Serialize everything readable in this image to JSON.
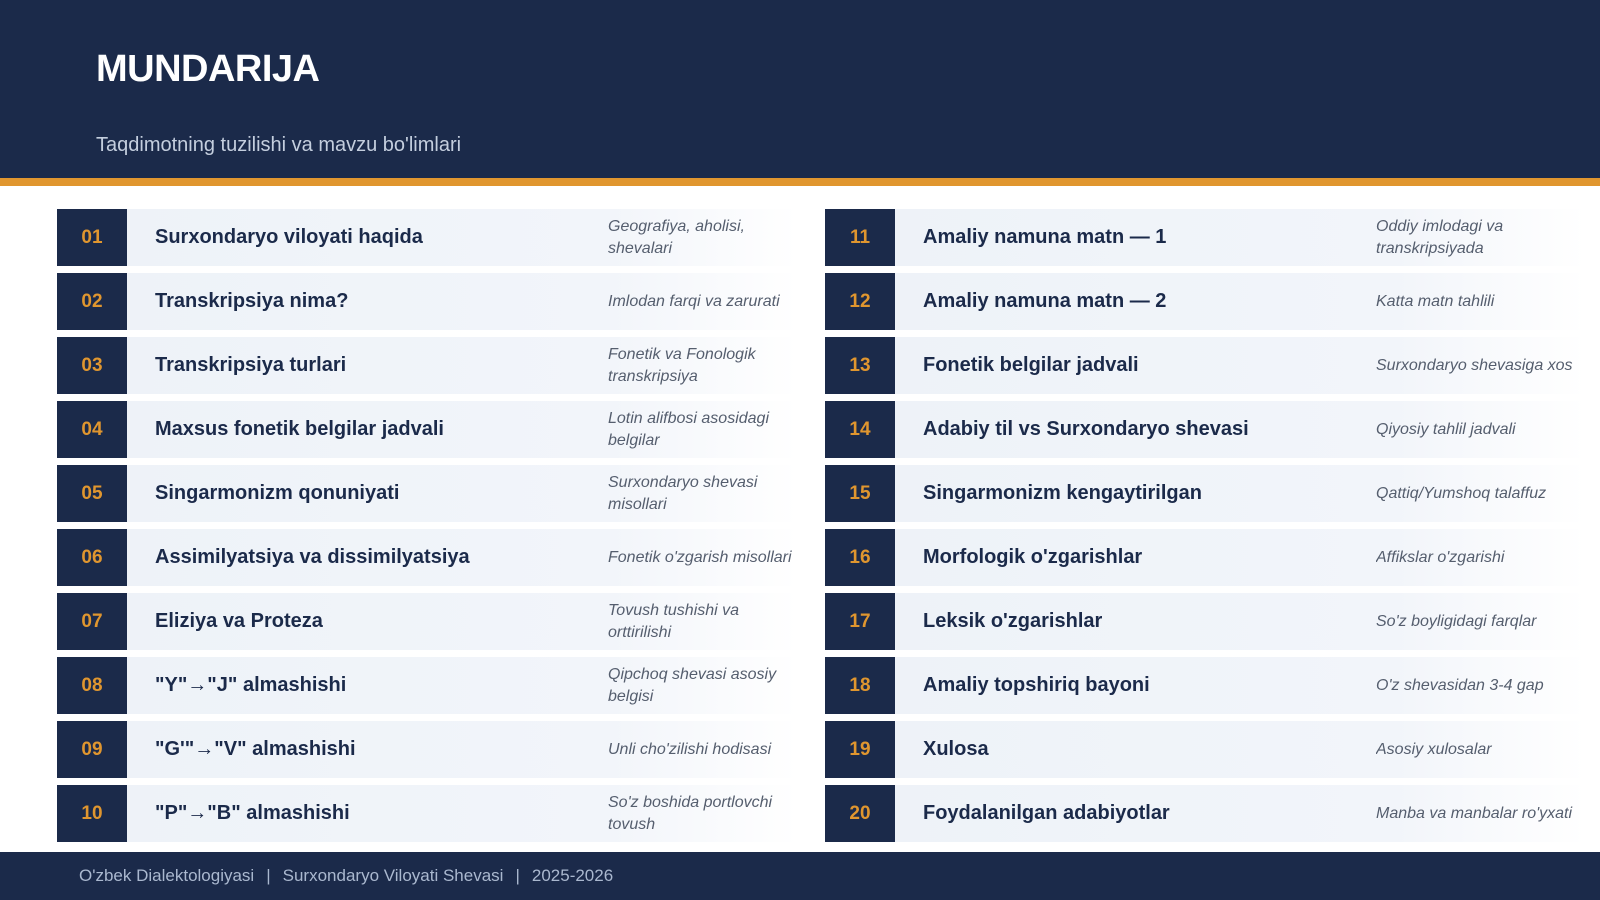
{
  "header": {
    "title": "MUNDARIJA",
    "subtitle": "Taqdimotning tuzilishi va mavzu bo'limlari"
  },
  "colors": {
    "navy": "#1b2a4a",
    "accent": "#e0962f",
    "row_bg": "#edf2f8"
  },
  "items_left": [
    {
      "num": "01",
      "title": "Surxondaryo viloyati haqida",
      "desc": "Geografiya, aholisi, shevalari"
    },
    {
      "num": "02",
      "title": "Transkripsiya nima?",
      "desc": "Imlodan farqi va zarurati"
    },
    {
      "num": "03",
      "title": "Transkripsiya turlari",
      "desc": "Fonetik va Fonologik transkripsiya"
    },
    {
      "num": "04",
      "title": "Maxsus fonetik belgilar jadvali",
      "desc": "Lotin alifbosi asosidagi belgilar"
    },
    {
      "num": "05",
      "title": "Singarmonizm qonuniyati",
      "desc": "Surxondaryo shevasi misollari"
    },
    {
      "num": "06",
      "title": "Assimilyatsiya va dissimilyatsiya",
      "desc": "Fonetik o'zgarish misollari"
    },
    {
      "num": "07",
      "title": "Eliziya va Proteza",
      "desc": "Tovush tushishi va orttirilishi"
    },
    {
      "num": "08",
      "title": "\"Y\"→\"J\" almashishi",
      "desc": "Qipchoq shevasi asosiy belgisi"
    },
    {
      "num": "09",
      "title": "\"G'\"→\"V\" almashishi",
      "desc": "Unli cho'zilishi hodisasi"
    },
    {
      "num": "10",
      "title": "\"P\"→\"B\" almashishi",
      "desc": "So'z boshida portlovchi tovush"
    }
  ],
  "items_right": [
    {
      "num": "11",
      "title": "Amaliy namuna matn — 1",
      "desc": "Oddiy imlodagi va transkripsiyada"
    },
    {
      "num": "12",
      "title": "Amaliy namuna matn — 2",
      "desc": "Katta matn tahlili"
    },
    {
      "num": "13",
      "title": "Fonetik belgilar jadvali",
      "desc": "Surxondaryo shevasiga xos"
    },
    {
      "num": "14",
      "title": "Adabiy til vs Surxondaryo shevasi",
      "desc": "Qiyosiy tahlil jadvali"
    },
    {
      "num": "15",
      "title": "Singarmonizm kengaytirilgan",
      "desc": "Qattiq/Yumshoq talaffuz"
    },
    {
      "num": "16",
      "title": "Morfologik o'zgarishlar",
      "desc": "Affikslar o'zgarishi"
    },
    {
      "num": "17",
      "title": "Leksik o'zgarishlar",
      "desc": "So'z boyligidagi farqlar"
    },
    {
      "num": "18",
      "title": "Amaliy topshiriq bayoni",
      "desc": "O'z shevasidan 3-4 gap"
    },
    {
      "num": "19",
      "title": "Xulosa",
      "desc": "Asosiy xulosalar"
    },
    {
      "num": "20",
      "title": "Foydalanilgan adabiyotlar",
      "desc": "Manba va manbalar ro'yxati"
    }
  ],
  "footer": {
    "course": "O'zbek Dialektologiyasi",
    "separator": "|",
    "topic": "Surxondaryo Viloyati Shevasi",
    "year": "2025-2026"
  }
}
